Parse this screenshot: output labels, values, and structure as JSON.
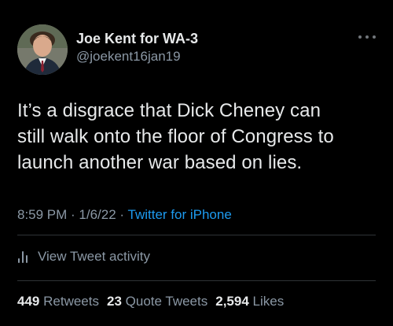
{
  "author": {
    "display_name": "Joe Kent for WA-3",
    "handle": "@joekent16jan19",
    "avatar_icon": "profile-photo"
  },
  "tweet": {
    "text_lines": [
      "It’s a disgrace that Dick Cheney can",
      "still walk onto the floor of Congress to",
      "launch another war based on lies."
    ],
    "time": "8:59 PM",
    "date": "1/6/22",
    "separator": " · ",
    "source": "Twitter for iPhone"
  },
  "actions": {
    "more_icon": "more-horizontal-icon",
    "activity_icon": "bar-chart-icon",
    "activity_label": "View Tweet activity"
  },
  "stats": {
    "retweets_count": "449",
    "retweets_label": "Retweets",
    "quote_count": "23",
    "quote_label": "Quote Tweets",
    "likes_count": "2,594",
    "likes_label": "Likes"
  },
  "colors": {
    "background": "#000000",
    "text_primary": "#e7e9ea",
    "text_secondary": "#8b98a5",
    "link": "#1d9bf0",
    "divider": "#2f3336"
  }
}
